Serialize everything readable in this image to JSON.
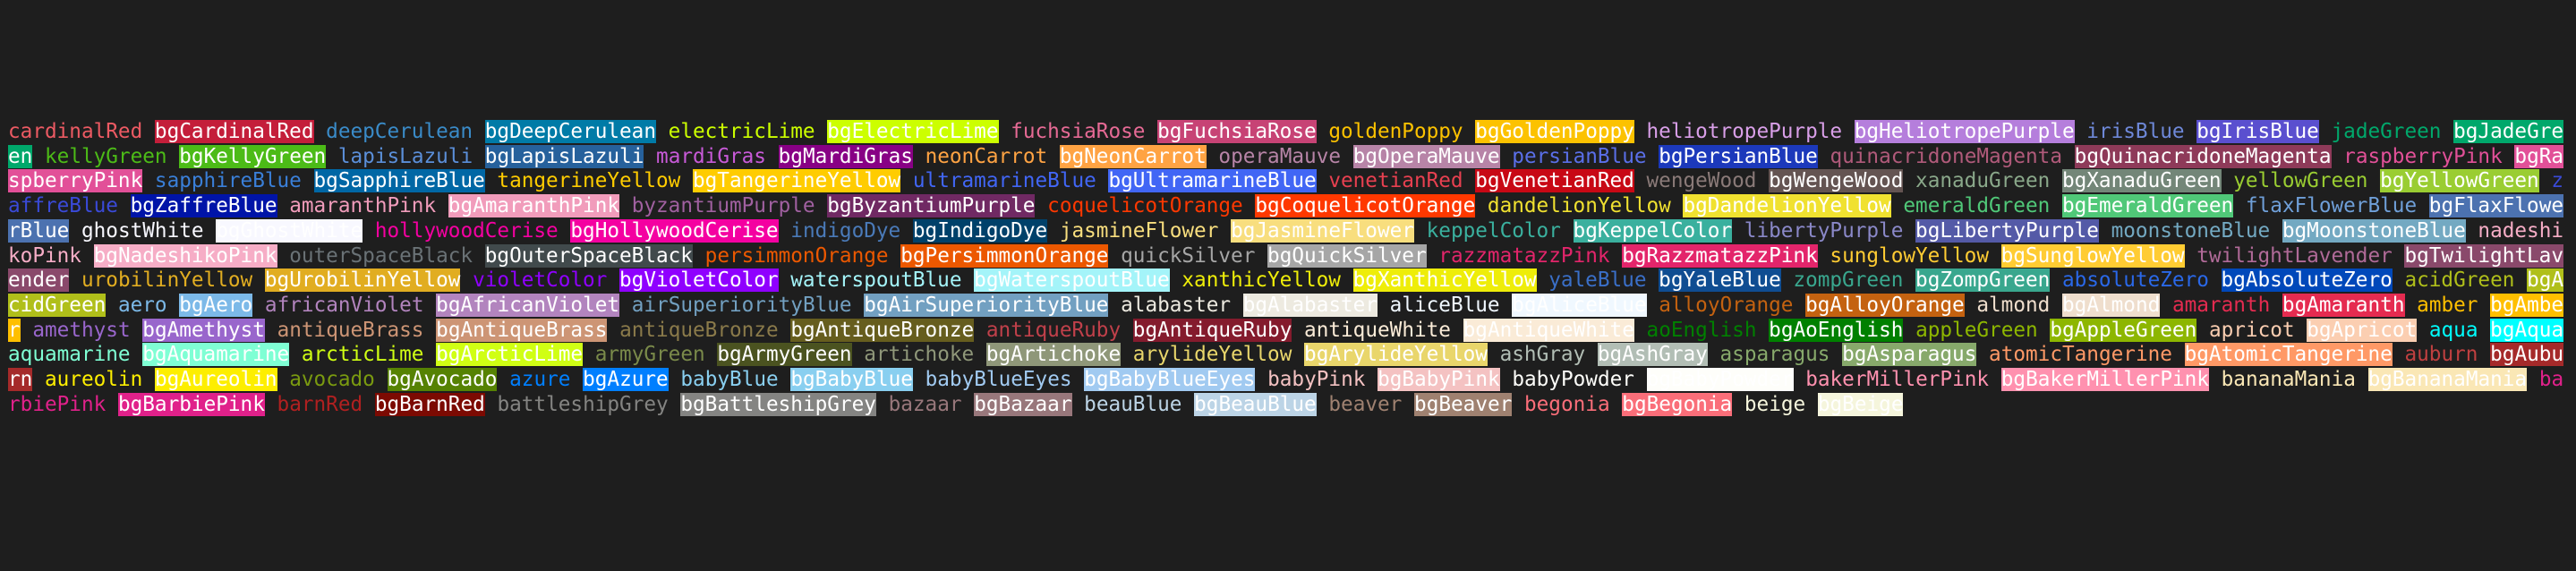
{
  "terminal": {
    "background": "#1e1e1e",
    "tokens": [
      {
        "t": "cardinalRed",
        "c": "#ec5a63"
      },
      {
        "t": "bgCardinalRed",
        "b": "#c41e3a"
      },
      {
        "t": "deepCerulean",
        "c": "#3a8bc8"
      },
      {
        "t": "bgDeepCerulean",
        "b": "#007ba7"
      },
      {
        "t": "electricLime",
        "c": "#ccff00"
      },
      {
        "t": "bgElectricLime",
        "b": "#ccff00"
      },
      {
        "t": "fuchsiaRose",
        "c": "#e66a95"
      },
      {
        "t": "bgFuchsiaRose",
        "b": "#c74375"
      },
      {
        "t": "goldenPoppy",
        "c": "#fcc200"
      },
      {
        "t": "bgGoldenPoppy",
        "b": "#fcc200"
      },
      {
        "t": "heliotropePurple",
        "c": "#d99fe8"
      },
      {
        "t": "bgHeliotropePurple",
        "b": "#b57edc"
      },
      {
        "t": "irisBlue",
        "c": "#6e88d8"
      },
      {
        "t": "bgIrisBlue",
        "b": "#5a4fcf"
      },
      {
        "t": "jadeGreen",
        "c": "#00a86b"
      },
      {
        "t": "bgJadeGreen",
        "b": "#00a86b"
      },
      {
        "t": "kellyGreen",
        "c": "#4cbb17"
      },
      {
        "t": "bgKellyGreen",
        "b": "#4cbb17"
      },
      {
        "t": "lapisLazuli",
        "c": "#5b8fd9"
      },
      {
        "t": "bgLapisLazuli",
        "b": "#26619c"
      },
      {
        "t": "mardiGras",
        "c": "#c85ad8"
      },
      {
        "t": "bgMardiGras",
        "b": "#880085"
      },
      {
        "t": "neonCarrot",
        "c": "#ffa343"
      },
      {
        "t": "bgNeonCarrot",
        "b": "#ffa343"
      },
      {
        "t": "operaMauve",
        "c": "#b784a7"
      },
      {
        "t": "bgOperaMauve",
        "b": "#b784a7"
      },
      {
        "t": "persianBlue",
        "c": "#5a6fe8"
      },
      {
        "t": "bgPersianBlue",
        "b": "#1c39bb"
      },
      {
        "t": "quinacridoneMagenta",
        "c": "#b05a7a"
      },
      {
        "t": "bgQuinacridoneMagenta",
        "b": "#8e3a59"
      },
      {
        "t": "raspberryPink",
        "c": "#e25098"
      },
      {
        "t": "bgRaspberryPink",
        "b": "#e25098"
      },
      {
        "t": "sapphireBlue",
        "c": "#3a7fd8"
      },
      {
        "t": "bgSapphireBlue",
        "b": "#0067a5"
      },
      {
        "t": "tangerineYellow",
        "c": "#ffcc00"
      },
      {
        "t": "bgTangerineYellow",
        "b": "#ffcc00"
      },
      {
        "t": "ultramarineBlue",
        "c": "#4166f5"
      },
      {
        "t": "bgUltramarineBlue",
        "b": "#4166f5"
      },
      {
        "t": "venetianRed",
        "c": "#e84050"
      },
      {
        "t": "bgVenetianRed",
        "b": "#c80815"
      },
      {
        "t": "wengeWood",
        "c": "#8a7a78"
      },
      {
        "t": "bgWengeWood",
        "b": "#645452"
      },
      {
        "t": "xanaduGreen",
        "c": "#8aa88a"
      },
      {
        "t": "bgXanaduGreen",
        "b": "#738678"
      },
      {
        "t": "yellowGreen",
        "c": "#9acd32"
      },
      {
        "t": "bgYellowGreen",
        "b": "#9acd32"
      },
      {
        "t": "zaffreBlue",
        "c": "#3a4ad8"
      },
      {
        "t": "bgZaffreBlue",
        "b": "#0014a8"
      },
      {
        "t": "amaranthPink",
        "c": "#f19cbb"
      },
      {
        "t": "bgAmaranthPink",
        "b": "#f19cbb"
      },
      {
        "t": "byzantiumPurple",
        "c": "#a060a0"
      },
      {
        "t": "bgByzantiumPurple",
        "b": "#702963"
      },
      {
        "t": "coquelicotOrange",
        "c": "#ff3800"
      },
      {
        "t": "bgCoquelicotOrange",
        "b": "#ff3800"
      },
      {
        "t": "dandelionYellow",
        "c": "#f0e130"
      },
      {
        "t": "bgDandelionYellow",
        "b": "#f0e130"
      },
      {
        "t": "emeraldGreen",
        "c": "#50c878"
      },
      {
        "t": "bgEmeraldGreen",
        "b": "#50c878"
      },
      {
        "t": "flaxFlowerBlue",
        "c": "#6f9fd8"
      },
      {
        "t": "bgFlaxFlowerBlue",
        "b": "#4c72b0"
      },
      {
        "t": "ghostWhite",
        "c": "#f8f8ff"
      },
      {
        "t": "bgGhostWhite",
        "b": "#f8f8ff"
      },
      {
        "t": "hollywoodCerise",
        "c": "#f400a1"
      },
      {
        "t": "bgHollywoodCerise",
        "b": "#f400a1"
      },
      {
        "t": "indigoDye",
        "c": "#4a7ab8"
      },
      {
        "t": "bgIndigoDye",
        "b": "#00416a"
      },
      {
        "t": "jasmineFlower",
        "c": "#f8de7e"
      },
      {
        "t": "bgJasmineFlower",
        "b": "#f8de7e"
      },
      {
        "t": "keppelColor",
        "c": "#3ab09e"
      },
      {
        "t": "bgKeppelColor",
        "b": "#3ab09e"
      },
      {
        "t": "libertyPurple",
        "c": "#8a88c8"
      },
      {
        "t": "bgLibertyPurple",
        "b": "#545aa7"
      },
      {
        "t": "moonstoneBlue",
        "c": "#73a9c2"
      },
      {
        "t": "bgMoonstoneBlue",
        "b": "#73a9c2"
      },
      {
        "t": "nadeshikoPink",
        "c": "#f6adc6"
      },
      {
        "t": "bgNadeshikoPink",
        "b": "#f6adc6"
      },
      {
        "t": "outerSpaceBlack",
        "c": "#6a7276"
      },
      {
        "t": "bgOuterSpaceBlack",
        "b": "#414a4c"
      },
      {
        "t": "persimmonOrange",
        "c": "#ec5800"
      },
      {
        "t": "bgPersimmonOrange",
        "b": "#ec5800"
      },
      {
        "t": "quickSilver",
        "c": "#a6a6a6"
      },
      {
        "t": "bgQuickSilver",
        "b": "#a6a6a6"
      },
      {
        "t": "razzmatazzPink",
        "c": "#e3256b"
      },
      {
        "t": "bgRazzmatazzPink",
        "b": "#e3256b"
      },
      {
        "t": "sunglowYellow",
        "c": "#ffcc33"
      },
      {
        "t": "bgSunglowYellow",
        "b": "#ffcc33"
      },
      {
        "t": "twilightLavender",
        "c": "#b06a98"
      },
      {
        "t": "bgTwilightLavender",
        "b": "#8a496b"
      },
      {
        "t": "urobilinYellow",
        "c": "#e1ad21"
      },
      {
        "t": "bgUrobilinYellow",
        "b": "#e1ad21"
      },
      {
        "t": "violetColor",
        "c": "#8f00ff"
      },
      {
        "t": "bgVioletColor",
        "b": "#8f00ff"
      },
      {
        "t": "waterspoutBlue",
        "c": "#a4f4f9"
      },
      {
        "t": "bgWaterspoutBlue",
        "b": "#a4f4f9"
      },
      {
        "t": "xanthicYellow",
        "c": "#eeed09"
      },
      {
        "t": "bgXanthicYellow",
        "b": "#eeed09"
      },
      {
        "t": "yaleBlue",
        "c": "#3a6fc8"
      },
      {
        "t": "bgYaleBlue",
        "b": "#0f4d92"
      },
      {
        "t": "zompGreen",
        "c": "#39a78e"
      },
      {
        "t": "bgZompGreen",
        "b": "#39a78e"
      },
      {
        "t": "absoluteZero",
        "c": "#2a68e8"
      },
      {
        "t": "bgAbsoluteZero",
        "b": "#0048ba"
      },
      {
        "t": "acidGreen",
        "c": "#b0bf1a"
      },
      {
        "t": "bgAcidGreen",
        "b": "#b0bf1a"
      },
      {
        "t": "aero",
        "c": "#7cb9e8"
      },
      {
        "t": "bgAero",
        "b": "#7cb9e8"
      },
      {
        "t": "africanViolet",
        "c": "#b284be"
      },
      {
        "t": "bgAfricanViolet",
        "b": "#b284be"
      },
      {
        "t": "airSuperiorityBlue",
        "c": "#72a0c1"
      },
      {
        "t": "bgAirSuperiorityBlue",
        "b": "#72a0c1"
      },
      {
        "t": "alabaster",
        "c": "#edeae0"
      },
      {
        "t": "bgAlabaster",
        "b": "#edeae0"
      },
      {
        "t": "aliceBlue",
        "c": "#f0f8ff"
      },
      {
        "t": "bgAliceBlue",
        "b": "#f0f8ff"
      },
      {
        "t": "alloyOrange",
        "c": "#c46210"
      },
      {
        "t": "bgAlloyOrange",
        "b": "#c46210"
      },
      {
        "t": "almond",
        "c": "#efdecd"
      },
      {
        "t": "bgAlmond",
        "b": "#efdecd"
      },
      {
        "t": "amaranth",
        "c": "#e52b50"
      },
      {
        "t": "bgAmaranth",
        "b": "#e52b50"
      },
      {
        "t": "amber",
        "c": "#ffbf00"
      },
      {
        "t": "bgAmber",
        "b": "#ffbf00"
      },
      {
        "t": "amethyst",
        "c": "#9966cc"
      },
      {
        "t": "bgAmethyst",
        "b": "#9966cc"
      },
      {
        "t": "antiqueBrass",
        "c": "#cd9575"
      },
      {
        "t": "bgAntiqueBrass",
        "b": "#cd9575"
      },
      {
        "t": "antiqueBronze",
        "c": "#8a7a4a"
      },
      {
        "t": "bgAntiqueBronze",
        "b": "#665d1e"
      },
      {
        "t": "antiqueRuby",
        "c": "#c0404a"
      },
      {
        "t": "bgAntiqueRuby",
        "b": "#841b2d"
      },
      {
        "t": "antiqueWhite",
        "c": "#faebd7"
      },
      {
        "t": "bgAntiqueWhite",
        "b": "#faebd7"
      },
      {
        "t": "aoEnglish",
        "c": "#008000"
      },
      {
        "t": "bgAoEnglish",
        "b": "#008000"
      },
      {
        "t": "appleGreen",
        "c": "#8db600"
      },
      {
        "t": "bgAppleGreen",
        "b": "#8db600"
      },
      {
        "t": "apricot",
        "c": "#fbceb1"
      },
      {
        "t": "bgApricot",
        "b": "#fbceb1"
      },
      {
        "t": "aqua",
        "c": "#00ffff"
      },
      {
        "t": "bgAqua",
        "b": "#00ffff"
      },
      {
        "t": "aquamarine",
        "c": "#7fffd4"
      },
      {
        "t": "bgAquamarine",
        "b": "#7fffd4"
      },
      {
        "t": "arcticLime",
        "c": "#d0ff14"
      },
      {
        "t": "bgArcticLime",
        "b": "#d0ff14"
      },
      {
        "t": "armyGreen",
        "c": "#7a8a4a"
      },
      {
        "t": "bgArmyGreen",
        "b": "#4b5320"
      },
      {
        "t": "artichoke",
        "c": "#8f9779"
      },
      {
        "t": "bgArtichoke",
        "b": "#8f9779"
      },
      {
        "t": "arylideYellow",
        "c": "#e9d66b"
      },
      {
        "t": "bgArylideYellow",
        "b": "#e9d66b"
      },
      {
        "t": "ashGray",
        "c": "#b2beb5"
      },
      {
        "t": "bgAshGray",
        "b": "#b2beb5"
      },
      {
        "t": "asparagus",
        "c": "#87a96b"
      },
      {
        "t": "bgAsparagus",
        "b": "#87a96b"
      },
      {
        "t": "atomicTangerine",
        "c": "#ff9966"
      },
      {
        "t": "bgAtomicTangerine",
        "b": "#ff9966"
      },
      {
        "t": "auburn",
        "c": "#c04040"
      },
      {
        "t": "bgAuburn",
        "b": "#a52a2a"
      },
      {
        "t": "aureolin",
        "c": "#fdee00"
      },
      {
        "t": "bgAureolin",
        "b": "#fdee00"
      },
      {
        "t": "avocado",
        "c": "#7a9a10"
      },
      {
        "t": "bgAvocado",
        "b": "#568203"
      },
      {
        "t": "azure",
        "c": "#007fff"
      },
      {
        "t": "bgAzure",
        "b": "#007fff"
      },
      {
        "t": "babyBlue",
        "c": "#89cff0"
      },
      {
        "t": "bgBabyBlue",
        "b": "#89cff0"
      },
      {
        "t": "babyBlueEyes",
        "c": "#a1caf1"
      },
      {
        "t": "bgBabyBlueEyes",
        "b": "#a1caf1"
      },
      {
        "t": "babyPink",
        "c": "#f4c2c2"
      },
      {
        "t": "bgBabyPink",
        "b": "#f4c2c2"
      },
      {
        "t": "babyPowder",
        "c": "#fefefa"
      },
      {
        "t": "bgBabyPowder",
        "b": "#fefefa"
      },
      {
        "t": "bakerMillerPink",
        "c": "#ff91af"
      },
      {
        "t": "bgBakerMillerPink",
        "b": "#ff91af"
      },
      {
        "t": "bananaMania",
        "c": "#fae7b5"
      },
      {
        "t": "bgBananaMania",
        "b": "#fae7b5"
      },
      {
        "t": "barbiePink",
        "c": "#e0218a"
      },
      {
        "t": "bgBarbiePink",
        "b": "#e0218a"
      },
      {
        "t": "barnRed",
        "c": "#b02020"
      },
      {
        "t": "bgBarnRed",
        "b": "#7c0a02"
      },
      {
        "t": "battleshipGrey",
        "c": "#848482"
      },
      {
        "t": "bgBattleshipGrey",
        "b": "#848482"
      },
      {
        "t": "bazaar",
        "c": "#98777b"
      },
      {
        "t": "bgBazaar",
        "b": "#98777b"
      },
      {
        "t": "beauBlue",
        "c": "#bcd4e6"
      },
      {
        "t": "bgBeauBlue",
        "b": "#bcd4e6"
      },
      {
        "t": "beaver",
        "c": "#9f8170"
      },
      {
        "t": "bgBeaver",
        "b": "#9f8170"
      },
      {
        "t": "begonia",
        "c": "#fa6e79"
      },
      {
        "t": "bgBegonia",
        "b": "#fa6e79"
      },
      {
        "t": "beige",
        "c": "#f5f5dc"
      },
      {
        "t": "bgBeige",
        "b": "#f5f5dc"
      }
    ]
  }
}
